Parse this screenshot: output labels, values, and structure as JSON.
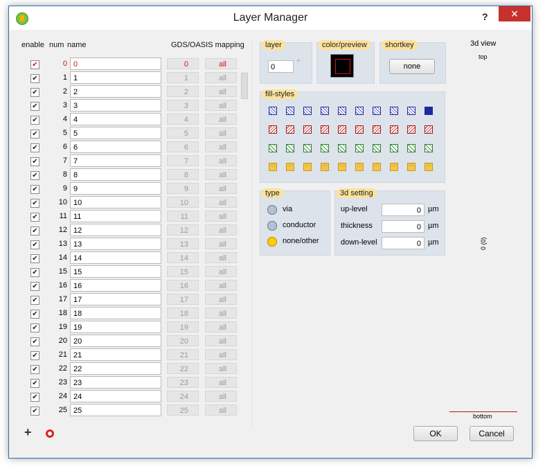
{
  "window": {
    "title": "Layer Manager",
    "help": "?",
    "close": "✕"
  },
  "table": {
    "headers": {
      "enable": "enable",
      "num": "num",
      "name": "name",
      "mapping": "GDS/OASIS mapping"
    },
    "check": "✔",
    "rows": [
      {
        "num": "0",
        "name": "0",
        "gds": "0",
        "oasis": "all",
        "highlight": true
      },
      {
        "num": "1",
        "name": "1",
        "gds": "1",
        "oasis": "all"
      },
      {
        "num": "2",
        "name": "2",
        "gds": "2",
        "oasis": "all"
      },
      {
        "num": "3",
        "name": "3",
        "gds": "3",
        "oasis": "all"
      },
      {
        "num": "4",
        "name": "4",
        "gds": "4",
        "oasis": "all"
      },
      {
        "num": "5",
        "name": "5",
        "gds": "5",
        "oasis": "all"
      },
      {
        "num": "6",
        "name": "6",
        "gds": "6",
        "oasis": "all"
      },
      {
        "num": "7",
        "name": "7",
        "gds": "7",
        "oasis": "all"
      },
      {
        "num": "8",
        "name": "8",
        "gds": "8",
        "oasis": "all"
      },
      {
        "num": "9",
        "name": "9",
        "gds": "9",
        "oasis": "all"
      },
      {
        "num": "10",
        "name": "10",
        "gds": "10",
        "oasis": "all"
      },
      {
        "num": "11",
        "name": "11",
        "gds": "11",
        "oasis": "all"
      },
      {
        "num": "12",
        "name": "12",
        "gds": "12",
        "oasis": "all"
      },
      {
        "num": "13",
        "name": "13",
        "gds": "13",
        "oasis": "all"
      },
      {
        "num": "14",
        "name": "14",
        "gds": "14",
        "oasis": "all"
      },
      {
        "num": "15",
        "name": "15",
        "gds": "15",
        "oasis": "all"
      },
      {
        "num": "16",
        "name": "16",
        "gds": "16",
        "oasis": "all"
      },
      {
        "num": "17",
        "name": "17",
        "gds": "17",
        "oasis": "all"
      },
      {
        "num": "18",
        "name": "18",
        "gds": "18",
        "oasis": "all"
      },
      {
        "num": "19",
        "name": "19",
        "gds": "19",
        "oasis": "all"
      },
      {
        "num": "20",
        "name": "20",
        "gds": "20",
        "oasis": "all"
      },
      {
        "num": "21",
        "name": "21",
        "gds": "21",
        "oasis": "all"
      },
      {
        "num": "22",
        "name": "22",
        "gds": "22",
        "oasis": "all"
      },
      {
        "num": "23",
        "name": "23",
        "gds": "23",
        "oasis": "all"
      },
      {
        "num": "24",
        "name": "24",
        "gds": "24",
        "oasis": "all"
      },
      {
        "num": "25",
        "name": "25",
        "gds": "25",
        "oasis": "all"
      }
    ]
  },
  "layer": {
    "label": "layer",
    "value": "0",
    "plus": "+"
  },
  "color": {
    "label": "color/preview"
  },
  "shortkey": {
    "label": "shortkey",
    "button": "none"
  },
  "fill_styles": {
    "label": "fill-styles",
    "row_colors": [
      "blue",
      "red",
      "green",
      "yellow"
    ]
  },
  "type": {
    "label": "type",
    "options": [
      {
        "label": "via",
        "selected": false
      },
      {
        "label": "conductor",
        "selected": false
      },
      {
        "label": "none/other",
        "selected": true
      }
    ]
  },
  "setting3d": {
    "label": "3d setting",
    "fields": [
      {
        "label": "up-level",
        "value": "0",
        "unit": "µm"
      },
      {
        "label": "thickness",
        "value": "0",
        "unit": "µm"
      },
      {
        "label": "down-level",
        "value": "0",
        "unit": "µm"
      }
    ]
  },
  "view3d": {
    "title": "3d view",
    "top": "top",
    "value": "0 (0)",
    "bottom": "bottom"
  },
  "footer": {
    "add": "+",
    "ok": "OK",
    "cancel": "Cancel"
  }
}
